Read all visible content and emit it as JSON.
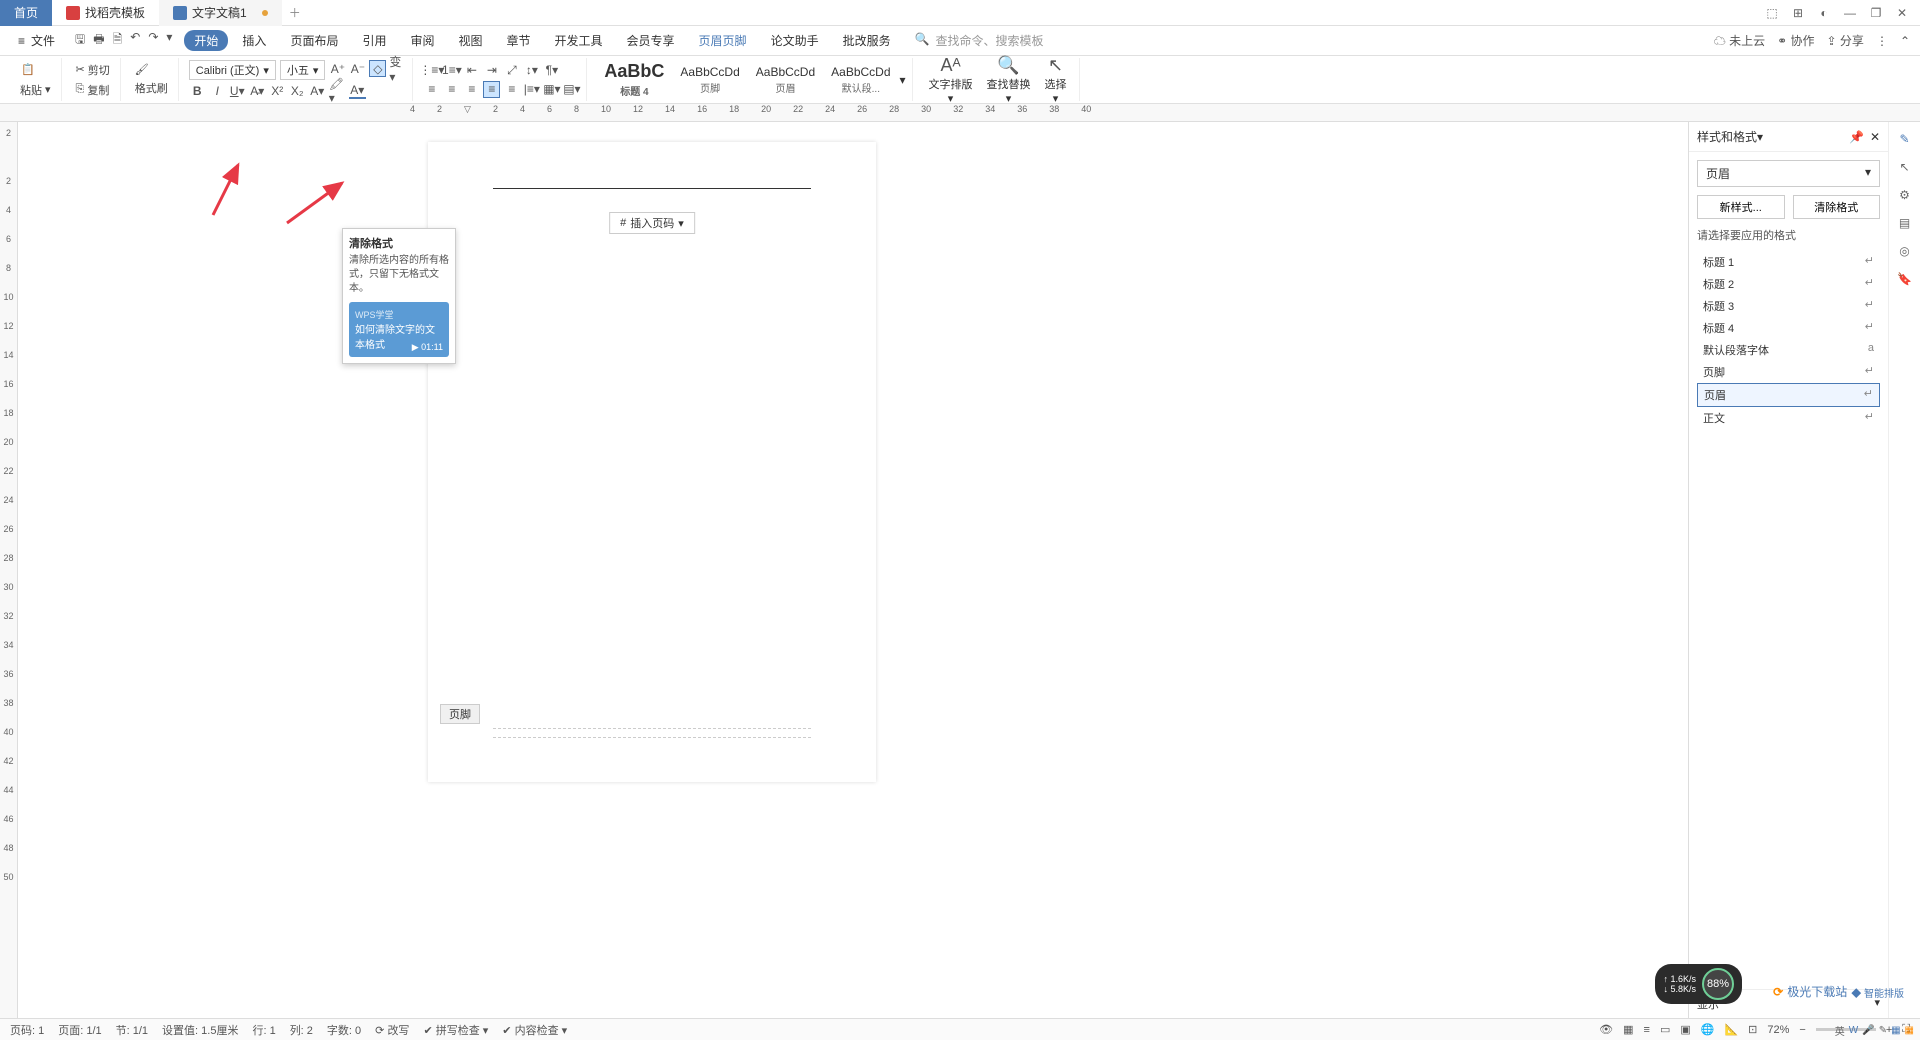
{
  "tabs": {
    "home": "首页",
    "template": "找稻壳模板",
    "doc": "文字文稿1"
  },
  "menu": {
    "file": "文件",
    "items": [
      "开始",
      "插入",
      "页面布局",
      "引用",
      "审阅",
      "视图",
      "章节",
      "开发工具",
      "会员专享",
      "页眉页脚",
      "论文助手",
      "批改服务"
    ],
    "search_placeholder": "查找命令、搜索模板",
    "cloud": "未上云",
    "coop": "协作",
    "share": "分享"
  },
  "toolbar": {
    "paste": "粘贴",
    "cut": "剪切",
    "copy": "复制",
    "format_brush": "格式刷",
    "font": "Calibri (正文)",
    "size": "小五",
    "styles": [
      {
        "preview": "AaBbC",
        "label": "标题 4",
        "big": true
      },
      {
        "preview": "AaBbCcDd",
        "label": "页脚"
      },
      {
        "preview": "AaBbCcDd",
        "label": "页眉"
      },
      {
        "preview": "AaBbCcDd",
        "label": "默认段..."
      }
    ],
    "text_layout": "文字排版",
    "find_replace": "查找替换",
    "select": "选择"
  },
  "tooltip": {
    "title": "清除格式",
    "desc": "清除所选内容的所有格式，只留下无格式文本。",
    "video_sub": "WPS学堂",
    "video_title": "如何清除文字的文本格式",
    "time": "01:11"
  },
  "page": {
    "insert_page_num": "插入页码",
    "footer_tag": "页脚"
  },
  "right_panel": {
    "title": "样式和格式",
    "current": "页眉",
    "new_style": "新样式...",
    "clear_format": "清除格式",
    "apply_label": "请选择要应用的格式",
    "items": [
      "标题 1",
      "标题 2",
      "标题 3",
      "标题 4",
      "默认段落字体",
      "页脚",
      "页眉",
      "正文"
    ],
    "selected": "页眉",
    "show_label": "显示",
    "smart_layout": "智能排版"
  },
  "statusbar": {
    "page": "页码: 1",
    "pages": "页面: 1/1",
    "section": "节: 1/1",
    "setting": "设置值: 1.5厘米",
    "line": "行: 1",
    "col": "列: 2",
    "words": "字数: 0",
    "rewrite": "改写",
    "spell": "拼写检查",
    "content": "内容检查",
    "zoom": "72%"
  },
  "speed": {
    "up": "1.6K/s",
    "down": "5.8K/s",
    "pct": "88%"
  },
  "watermark": "极光下载站",
  "tray": "英"
}
